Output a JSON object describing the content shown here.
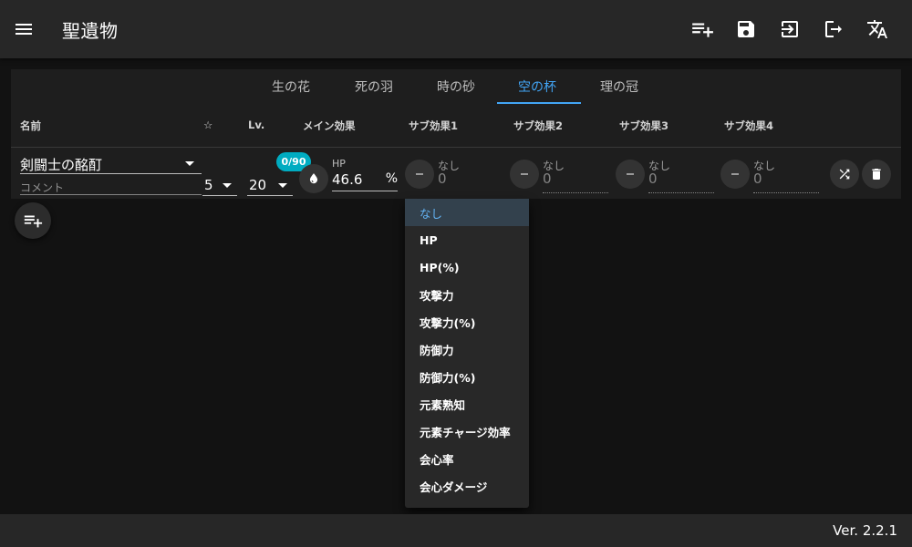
{
  "app": {
    "title": "聖遺物",
    "version": "Ver. 2.2.1"
  },
  "toolbar": {
    "actions": [
      {
        "name": "add-list-icon"
      },
      {
        "name": "save-icon"
      },
      {
        "name": "import-icon"
      },
      {
        "name": "export-icon"
      },
      {
        "name": "translate-icon"
      }
    ]
  },
  "tabs": [
    {
      "label": "生の花",
      "active": false
    },
    {
      "label": "死の羽",
      "active": false
    },
    {
      "label": "時の砂",
      "active": false
    },
    {
      "label": "空の杯",
      "active": true
    },
    {
      "label": "理の冠",
      "active": false
    }
  ],
  "columns": {
    "name": "名前",
    "star": "☆",
    "level": "Lv.",
    "main": "メイン効果",
    "sub1": "サブ効果1",
    "sub2": "サブ効果2",
    "sub3": "サブ効果3",
    "sub4": "サブ効果4"
  },
  "artifact": {
    "name": "剣闘士の酩酊",
    "comment_placeholder": "コメント",
    "rarity": "5",
    "level": "20",
    "level_badge": "0/90",
    "main_stat_label": "HP",
    "main_stat_value": "46.6",
    "main_stat_unit": "%",
    "substats": [
      {
        "label": "なし",
        "value": "0"
      },
      {
        "label": "なし",
        "value": "0"
      },
      {
        "label": "なし",
        "value": "0"
      },
      {
        "label": "なし",
        "value": "0"
      }
    ]
  },
  "dropdown": {
    "options": [
      "なし",
      "HP",
      "HP(%)",
      "攻撃力",
      "攻撃力(%)",
      "防御力",
      "防御力(%)",
      "元素熟知",
      "元素チャージ効率",
      "会心率",
      "会心ダメージ"
    ],
    "selected": "なし"
  },
  "colors": {
    "accent": "#42a5f5",
    "badge": "#00acc1",
    "appbar": "#272727",
    "background": "#121212"
  }
}
